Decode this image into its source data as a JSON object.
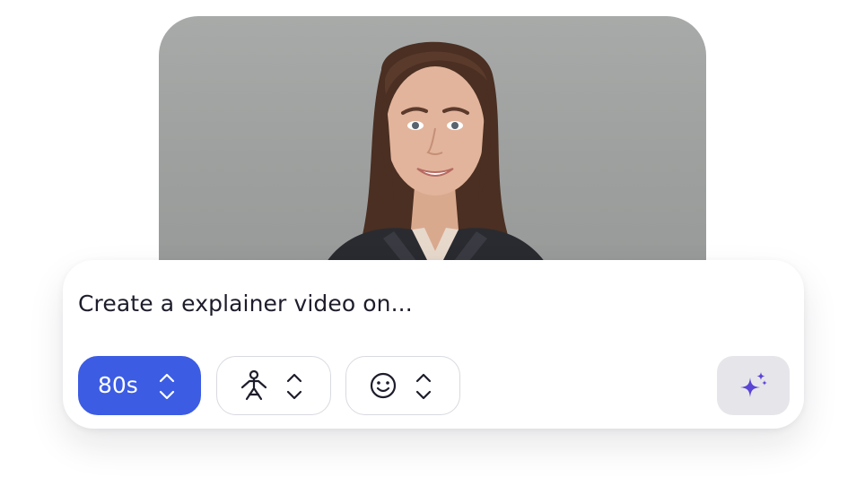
{
  "prompt": {
    "text": "Create a explainer video on..."
  },
  "controls": {
    "duration": {
      "value": "80s",
      "icon": "chevron-up-down-icon"
    },
    "avatar": {
      "icon": "person-icon",
      "stepper_icon": "chevron-up-down-icon"
    },
    "emotion": {
      "icon": "smiley-icon",
      "stepper_icon": "chevron-up-down-icon"
    },
    "generate": {
      "icon": "sparkles-icon"
    }
  },
  "preview": {
    "subject": "presenter-portrait"
  },
  "colors": {
    "accent": "#3c5ce3",
    "sparkle": "#5a45d6",
    "photo_background": "#a0a2a1",
    "generate_bg": "#e6e6ea"
  }
}
